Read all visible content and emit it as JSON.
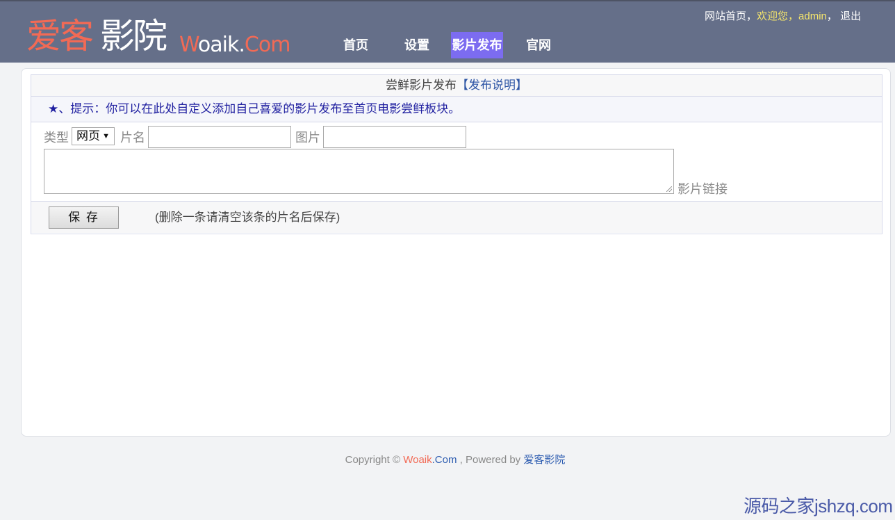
{
  "brand": {
    "cn_part1": "爱客",
    "cn_part2": "影院",
    "en_w": "W",
    "en_mid": "oaik.",
    "en_c": "Com"
  },
  "nav": {
    "items": [
      "首页",
      "设置",
      "影片发布",
      "官网"
    ],
    "active": "影片发布"
  },
  "toplinks": {
    "home": "网站首页",
    "sep1": "，",
    "welcome": "欢迎您，",
    "user": "admin",
    "sep2": "，",
    "logout": "退出"
  },
  "main": {
    "title": "尝鲜影片发布",
    "title_link": "【发布说明】",
    "tip": "★、提示：你可以在此处自定义添加自己喜爱的影片发布至首页电影尝鲜板块。",
    "form": {
      "type_label": "类型",
      "type_value": "网页",
      "name_label": "片名",
      "name_value": "",
      "image_label": "图片",
      "image_value": "",
      "link_label": "影片链接",
      "link_value": ""
    },
    "save_label": "保 存",
    "note": "(删除一条请清空该条的片名后保存)"
  },
  "footer": {
    "prefix": "Copyright © ",
    "site_w": "Woaik",
    "site_c": ".Com",
    "middle": " , Powered by ",
    "powered": "爱客影院"
  },
  "watermark": "源码之家jshzq.com",
  "colors": {
    "header_bg": "#656f89",
    "nav_active_bg": "#7c6cf0",
    "brand_orange": "#f26a55",
    "link_blue": "#2d55a5",
    "tip_blue": "#1f1fa0",
    "welcome_yellow": "#f5e56c"
  }
}
